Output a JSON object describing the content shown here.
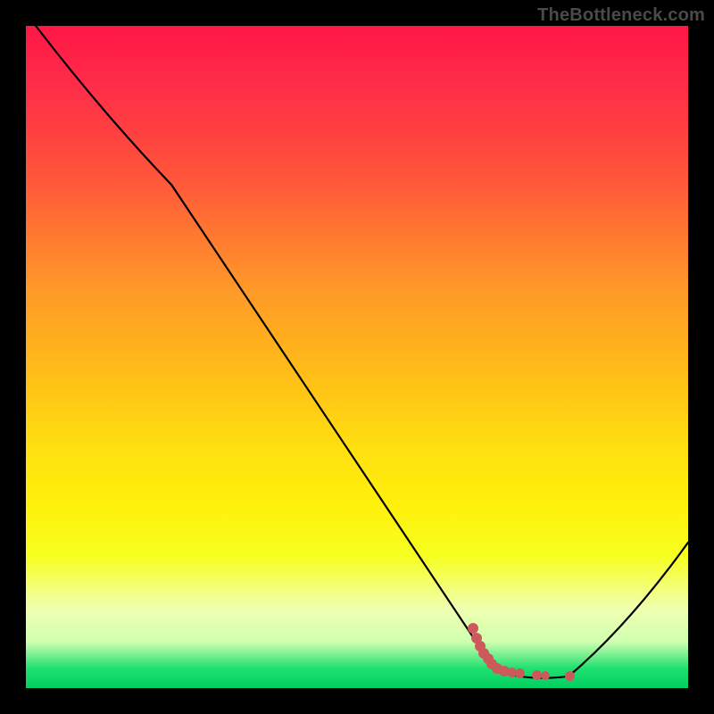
{
  "attribution": "TheBottleneck.com",
  "colors": {
    "curve_stroke": "#000000",
    "dot_fill": "#cc5a5a",
    "background_frame": "#000000",
    "gradient_top": "#ff1744",
    "gradient_bottom": "#00d060"
  },
  "chart_data": {
    "type": "line",
    "title": "",
    "xlabel": "",
    "ylabel": "",
    "xlim": [
      0,
      100
    ],
    "ylim": [
      0,
      100
    ],
    "grid": false,
    "legend": false,
    "curve": [
      {
        "x": 1.5,
        "y": 100
      },
      {
        "x": 22,
        "y": 76
      },
      {
        "x": 71,
        "y": 2.5
      },
      {
        "x": 82,
        "y": 1.8
      },
      {
        "x": 100,
        "y": 22
      }
    ],
    "series": [
      {
        "name": "markers",
        "color": "#cc5a5a",
        "points": [
          {
            "x": 67.5,
            "y": 9.0,
            "r": 6
          },
          {
            "x": 68.0,
            "y": 7.5,
            "r": 6
          },
          {
            "x": 68.6,
            "y": 6.4,
            "r": 6
          },
          {
            "x": 69.2,
            "y": 5.3,
            "r": 6
          },
          {
            "x": 69.8,
            "y": 4.4,
            "r": 6
          },
          {
            "x": 70.4,
            "y": 3.6,
            "r": 6
          },
          {
            "x": 71.2,
            "y": 3.0,
            "r": 6
          },
          {
            "x": 72.2,
            "y": 2.6,
            "r": 6
          },
          {
            "x": 73.4,
            "y": 2.3,
            "r": 5.5
          },
          {
            "x": 74.6,
            "y": 2.2,
            "r": 5.5
          },
          {
            "x": 77.2,
            "y": 2.0,
            "r": 5.5
          },
          {
            "x": 78.5,
            "y": 1.9,
            "r": 5.0
          },
          {
            "x": 82.2,
            "y": 1.8,
            "r": 5.5
          }
        ]
      }
    ]
  }
}
